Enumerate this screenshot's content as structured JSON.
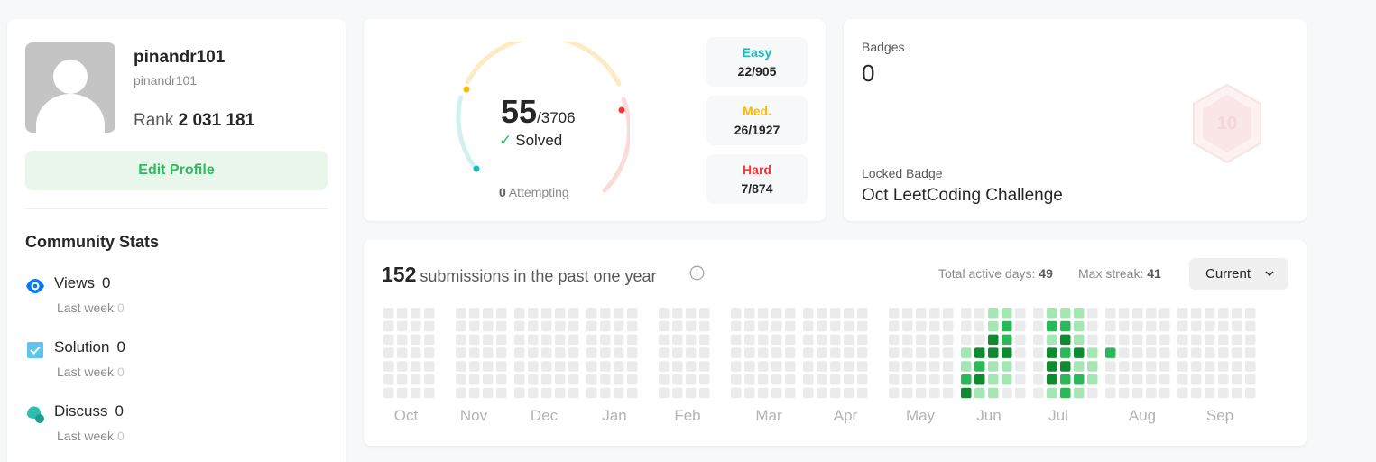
{
  "profile": {
    "display_name": "pinandr101",
    "username": "pinandr101",
    "rank_label": "Rank",
    "rank_value": "2 031 181",
    "edit_button": "Edit Profile"
  },
  "community": {
    "title": "Community Stats",
    "stats": [
      {
        "name": "Views",
        "value": "0",
        "sub_label": "Last week",
        "sub_value": "0",
        "icon": "eye-icon",
        "color": "#007aff"
      },
      {
        "name": "Solution",
        "value": "0",
        "sub_label": "Last week",
        "sub_value": "0",
        "icon": "checkbox-icon",
        "color": "#5fc4f0"
      },
      {
        "name": "Discuss",
        "value": "0",
        "sub_label": "Last week",
        "sub_value": "0",
        "icon": "discuss-icon",
        "color": "#2bbfae"
      }
    ]
  },
  "solved": {
    "count": "55",
    "total": "/3706",
    "label": "Solved",
    "attempting_count": "0",
    "attempting_label": "Attempting",
    "difficulties": [
      {
        "name": "Easy",
        "value": "22/905",
        "color": "#1cbaba"
      },
      {
        "name": "Med.",
        "value": "26/1927",
        "color": "#ffb800"
      },
      {
        "name": "Hard",
        "value": "7/874",
        "color": "#f63737"
      }
    ]
  },
  "badges": {
    "title": "Badges",
    "count": "0",
    "locked_label": "Locked Badge",
    "locked_name": "Oct LeetCoding Challenge",
    "badge_text": "10"
  },
  "submissions": {
    "count": "152",
    "label": "submissions in the past one year",
    "active_days_label": "Total active days:",
    "active_days": "49",
    "max_streak_label": "Max streak:",
    "max_streak": "41",
    "select_value": "Current",
    "months": [
      "Oct",
      "Nov",
      "Dec",
      "Jan",
      "Feb",
      "Mar",
      "Apr",
      "May",
      "Jun",
      "Jul",
      "Aug",
      "Sep"
    ],
    "colors": {
      "empty": "#ebebeb",
      "l1": "#a6e6b5",
      "l2": "#2cb75a",
      "l3": "#108a30"
    }
  }
}
